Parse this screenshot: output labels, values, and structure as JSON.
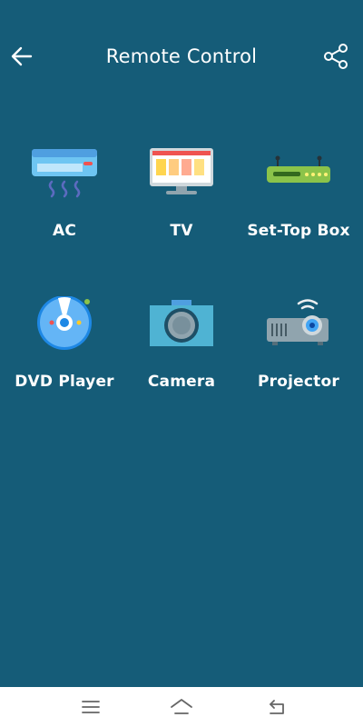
{
  "header": {
    "title": "Remote Control",
    "back_icon": "arrow-left-icon",
    "share_icon": "share-icon"
  },
  "devices": [
    {
      "label": "AC",
      "icon": "air-conditioner-icon"
    },
    {
      "label": "TV",
      "icon": "tv-icon"
    },
    {
      "label": "Set-Top Box",
      "icon": "set-top-box-icon"
    },
    {
      "label": "DVD Player",
      "icon": "dvd-disc-icon"
    },
    {
      "label": "Camera",
      "icon": "camera-icon"
    },
    {
      "label": "Projector",
      "icon": "projector-icon"
    }
  ],
  "navbar": {
    "menu_icon": "menu-icon",
    "home_icon": "home-icon",
    "back_icon": "back-icon"
  },
  "colors": {
    "background": "#155c78",
    "navbar": "#ffffff",
    "accent": "#1e88e5"
  }
}
